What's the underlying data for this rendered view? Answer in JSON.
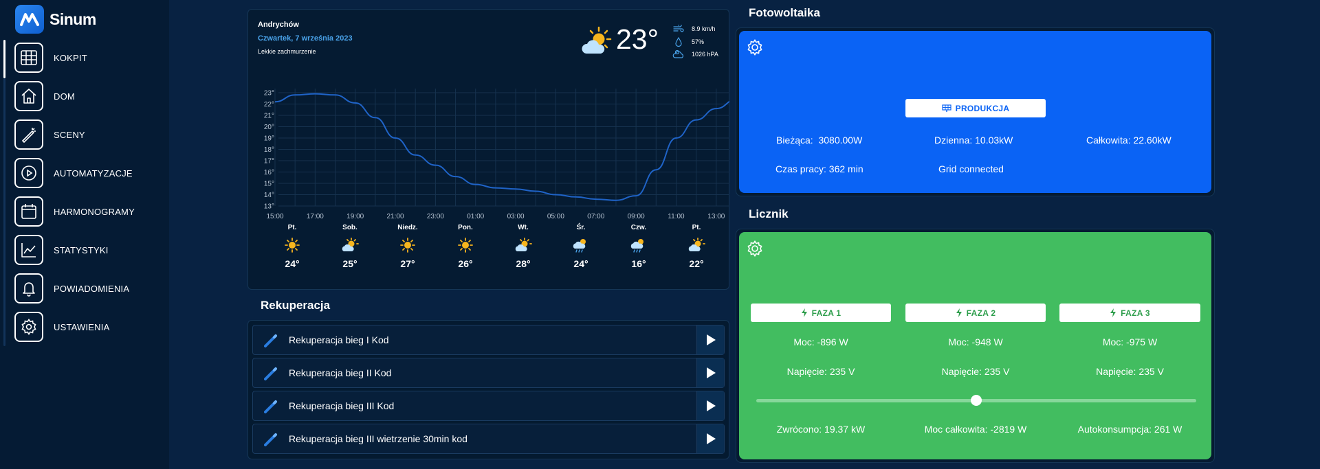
{
  "app": {
    "name": "Sinum"
  },
  "nav": [
    {
      "label": "KOKPIT",
      "icon": "grid-icon",
      "active": true
    },
    {
      "label": "DOM",
      "icon": "home-icon"
    },
    {
      "label": "SCENY",
      "icon": "wand-icon"
    },
    {
      "label": "AUTOMATYZACJE",
      "icon": "play-circle-icon"
    },
    {
      "label": "HARMONOGRAMY",
      "icon": "calendar-icon"
    },
    {
      "label": "STATYSTYKI",
      "icon": "chart-icon"
    },
    {
      "label": "POWIADOMIENIA",
      "icon": "bell-icon"
    },
    {
      "label": "USTAWIENIA",
      "icon": "gear-icon"
    }
  ],
  "weather": {
    "city": "Andrychów",
    "date": "Czwartek, 7 września 2023",
    "description": "Lekkie zachmurzenie",
    "temperature": "23°",
    "wind": "8.9 km/h",
    "humidity": "57%",
    "pressure": "1026 hPA",
    "forecast": [
      {
        "day": "Pt.",
        "temp": "24°",
        "icon": "sun"
      },
      {
        "day": "Sob.",
        "temp": "25°",
        "icon": "sun-cloud"
      },
      {
        "day": "Niedz.",
        "temp": "27°",
        "icon": "sun"
      },
      {
        "day": "Pon.",
        "temp": "26°",
        "icon": "sun"
      },
      {
        "day": "Wt.",
        "temp": "28°",
        "icon": "sun-cloud"
      },
      {
        "day": "Śr.",
        "temp": "24°",
        "icon": "rain-sun"
      },
      {
        "day": "Czw.",
        "temp": "16°",
        "icon": "rain-sun"
      },
      {
        "day": "Pt.",
        "temp": "22°",
        "icon": "sun-cloud"
      }
    ]
  },
  "chart_data": {
    "type": "line",
    "x": [
      "15:00",
      "16:00",
      "17:00",
      "18:00",
      "19:00",
      "20:00",
      "21:00",
      "22:00",
      "23:00",
      "00:00",
      "01:00",
      "02:00",
      "03:00",
      "04:00",
      "05:00",
      "06:00",
      "07:00",
      "08:00",
      "09:00",
      "10:00",
      "11:00",
      "12:00",
      "13:00",
      "14:00"
    ],
    "x_tick_labels": [
      "15:00",
      "17:00",
      "19:00",
      "21:00",
      "23:00",
      "01:00",
      "03:00",
      "05:00",
      "07:00",
      "09:00",
      "11:00",
      "13:00"
    ],
    "y_tick_labels": [
      "23°",
      "22°",
      "21°",
      "20°",
      "19°",
      "18°",
      "17°",
      "16°",
      "15°",
      "14°",
      "13°"
    ],
    "series": [
      {
        "values": [
          22.2,
          22.8,
          22.9,
          22.8,
          22.1,
          20.8,
          19.0,
          17.5,
          16.6,
          15.6,
          14.9,
          14.6,
          14.5,
          14.3,
          14.0,
          13.8,
          13.6,
          13.5,
          13.9,
          16.2,
          19.0,
          20.6,
          21.6,
          22.4
        ]
      }
    ],
    "ylim": [
      13,
      23
    ],
    "grid": true,
    "color": "#1f63c7"
  },
  "rekuperacja": {
    "title": "Rekuperacja",
    "items": [
      {
        "label": "Rekuperacja bieg I Kod"
      },
      {
        "label": "Rekuperacja bieg II Kod"
      },
      {
        "label": "Rekuperacja bieg III Kod"
      },
      {
        "label": "Rekuperacja bieg III wietrzenie 30min kod"
      }
    ]
  },
  "fotowoltaika": {
    "title": "Fotowoltaika",
    "button_label": "PRODUKCJA",
    "current_label": "Bieżąca:",
    "current_value": "3080.00W",
    "daily": "Dzienna: 10.03kW",
    "total": "Całkowita: 22.60kW",
    "uptime": "Czas pracy: 362 min",
    "status": "Grid connected",
    "color": "#0a63f5"
  },
  "licznik": {
    "title": "Licznik",
    "color": "#42bd60",
    "phases": [
      {
        "label": "FAZA 1",
        "power": "Moc: -896 W",
        "voltage": "Napięcie: 235 V"
      },
      {
        "label": "FAZA 2",
        "power": "Moc: -948 W",
        "voltage": "Napięcie: 235 V"
      },
      {
        "label": "FAZA 3",
        "power": "Moc: -975 W",
        "voltage": "Napięcie: 235 V"
      }
    ],
    "slider_value": 0.5,
    "returned": "Zwrócono: 19.37 kW",
    "total_power": "Moc całkowita: -2819 W",
    "autoconsumption": "Autokonsumpcja: 261 W"
  }
}
